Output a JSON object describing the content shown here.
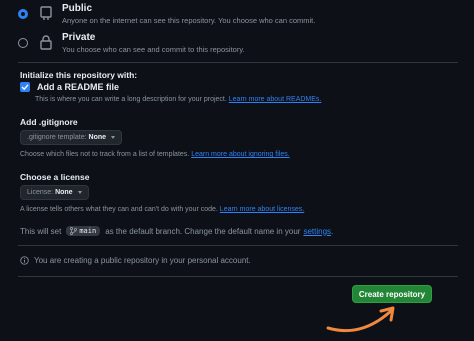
{
  "visibility": {
    "public": {
      "title": "Public",
      "description": "Anyone on the internet can see this repository. You choose who can commit."
    },
    "private": {
      "title": "Private",
      "description": "You choose who can see and commit to this repository."
    }
  },
  "initialize": {
    "heading": "Initialize this repository with:",
    "readme_label": "Add a README file",
    "readme_desc": "This is where you can write a long description for your project.",
    "readme_link": "Learn more about READMEs."
  },
  "gitignore": {
    "heading": "Add .gitignore",
    "select_prefix": ".gitignore template:",
    "select_value": "None",
    "desc": "Choose which files not to track from a list of templates.",
    "link": "Learn more about ignoring files."
  },
  "license": {
    "heading": "Choose a license",
    "select_prefix": "License:",
    "select_value": "None",
    "desc": "A license tells others what they can and can't do with your code.",
    "link": "Learn more about licenses."
  },
  "branch": {
    "prefix": "This will set",
    "name": "main",
    "middle": "as the default branch. Change the default name in your",
    "link": "settings",
    "suffix": "."
  },
  "notice": {
    "text": "You are creating a public repository in your personal account."
  },
  "actions": {
    "create_label": "Create repository"
  },
  "colors": {
    "accent": "#2f81f7",
    "primary_button": "#238636",
    "annotation_arrow": "#f0883e"
  }
}
